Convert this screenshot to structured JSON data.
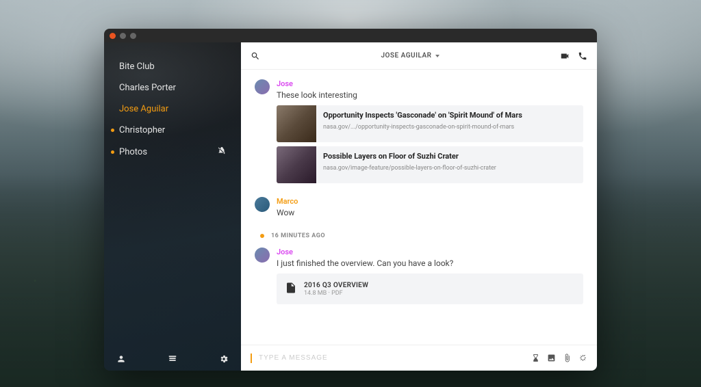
{
  "sidebar": {
    "items": [
      {
        "label": "Bite Club",
        "active": false,
        "unread": false,
        "muted": false
      },
      {
        "label": "Charles Porter",
        "active": false,
        "unread": false,
        "muted": false
      },
      {
        "label": "Jose Aguilar",
        "active": true,
        "unread": false,
        "muted": false
      },
      {
        "label": "Christopher",
        "active": false,
        "unread": true,
        "muted": false
      },
      {
        "label": "Photos",
        "active": false,
        "unread": true,
        "muted": true
      }
    ]
  },
  "header": {
    "title": "JOSE AGUILAR"
  },
  "chat": {
    "messages": [
      {
        "sender": "Jose",
        "sender_kind": "jose",
        "text": "These look interesting",
        "links": [
          {
            "title": "Opportunity Inspects 'Gasconade' on 'Spirit Mound' of Mars",
            "url": "nasa.gov/.../opportunity-inspects-gasconade-on-spirit-mound-of-mars"
          },
          {
            "title": "Possible Layers on Floor of Suzhi Crater",
            "url": "nasa.gov/image-feature/possible-layers-on-floor-of-suzhi-crater"
          }
        ]
      },
      {
        "sender": "Marco",
        "sender_kind": "marco",
        "text": "Wow"
      }
    ],
    "time_divider": "16 MINUTES AGO",
    "messages_after": [
      {
        "sender": "Jose",
        "sender_kind": "jose",
        "text": "I just finished the overview. Can you have a look?",
        "file": {
          "name": "2016 Q3 OVERVIEW",
          "size": "14.8 MB",
          "type": "PDF"
        }
      }
    ]
  },
  "composer": {
    "placeholder": "TYPE A MESSAGE"
  }
}
